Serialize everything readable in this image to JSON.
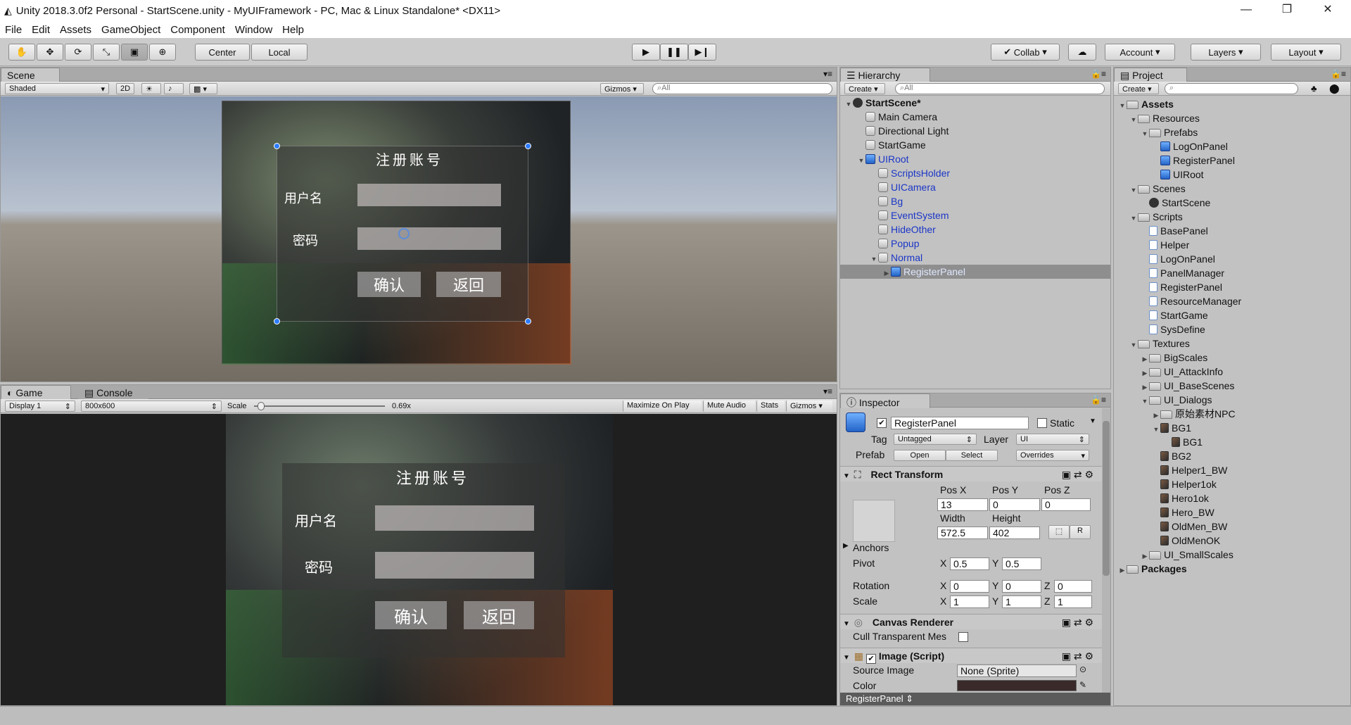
{
  "window": {
    "title": "Unity 2018.3.0f2 Personal - StartScene.unity - MyUIFramework - PC, Mac & Linux Standalone* <DX11>"
  },
  "menu": [
    "File",
    "Edit",
    "Assets",
    "GameObject",
    "Component",
    "Window",
    "Help"
  ],
  "toolbar": {
    "pivot": "Center",
    "space": "Local",
    "collab": "Collab",
    "account": "Account",
    "layers": "Layers",
    "layout": "Layout"
  },
  "scene": {
    "tab": "Scene",
    "shading": "Shaded",
    "mode2d": "2D",
    "gizmos": "Gizmos",
    "search": "All",
    "panel_title": "注册账号",
    "username_label": "用户名",
    "password_label": "密码",
    "confirm_label": "确认",
    "back_label": "返回"
  },
  "game": {
    "tab": "Game",
    "console_tab": "Console",
    "display": "Display 1",
    "resolution": "800x600",
    "scale_label": "Scale",
    "scale_value": "0.69x",
    "scale_fraction": 0.03,
    "maximize": "Maximize On Play",
    "mute": "Mute Audio",
    "stats": "Stats",
    "gizmos": "Gizmos",
    "panel_title": "注册账号",
    "username_label": "用户名",
    "password_label": "密码",
    "confirm_label": "确认",
    "back_label": "返回"
  },
  "hierarchy": {
    "tab": "Hierarchy",
    "create": "Create",
    "search": "All",
    "items": [
      {
        "label": "StartScene*",
        "depth": 0,
        "arrow": "open",
        "icon": "scene",
        "bold": true
      },
      {
        "label": "Main Camera",
        "depth": 1,
        "arrow": "",
        "icon": "go"
      },
      {
        "label": "Directional Light",
        "depth": 1,
        "arrow": "",
        "icon": "go"
      },
      {
        "label": "StartGame",
        "depth": 1,
        "arrow": "",
        "icon": "go"
      },
      {
        "label": "UIRoot",
        "depth": 1,
        "arrow": "open",
        "icon": "prefab",
        "blue": true
      },
      {
        "label": "ScriptsHolder",
        "depth": 2,
        "arrow": "",
        "icon": "go",
        "blue": true
      },
      {
        "label": "UICamera",
        "depth": 2,
        "arrow": "",
        "icon": "go",
        "blue": true
      },
      {
        "label": "Bg",
        "depth": 2,
        "arrow": "",
        "icon": "go",
        "blue": true
      },
      {
        "label": "EventSystem",
        "depth": 2,
        "arrow": "",
        "icon": "go",
        "blue": true
      },
      {
        "label": "HideOther",
        "depth": 2,
        "arrow": "",
        "icon": "go",
        "blue": true
      },
      {
        "label": "Popup",
        "depth": 2,
        "arrow": "",
        "icon": "go",
        "blue": true
      },
      {
        "label": "Normal",
        "depth": 2,
        "arrow": "open",
        "icon": "go",
        "blue": true
      },
      {
        "label": "RegisterPanel",
        "depth": 3,
        "arrow": "closed",
        "icon": "prefab",
        "selected": true
      }
    ]
  },
  "project": {
    "tab": "Project",
    "create": "Create",
    "items": [
      {
        "label": "Assets",
        "depth": 0,
        "arrow": "open",
        "icon": "folder",
        "bold": true
      },
      {
        "label": "Resources",
        "depth": 1,
        "arrow": "open",
        "icon": "folder"
      },
      {
        "label": "Prefabs",
        "depth": 2,
        "arrow": "open",
        "icon": "folder"
      },
      {
        "label": "LogOnPanel",
        "depth": 3,
        "arrow": "",
        "icon": "prefab"
      },
      {
        "label": "RegisterPanel",
        "depth": 3,
        "arrow": "",
        "icon": "prefab"
      },
      {
        "label": "UIRoot",
        "depth": 3,
        "arrow": "",
        "icon": "prefab"
      },
      {
        "label": "Scenes",
        "depth": 1,
        "arrow": "open",
        "icon": "folder"
      },
      {
        "label": "StartScene",
        "depth": 2,
        "arrow": "",
        "icon": "scene"
      },
      {
        "label": "Scripts",
        "depth": 1,
        "arrow": "open",
        "icon": "folder"
      },
      {
        "label": "BasePanel",
        "depth": 2,
        "arrow": "",
        "icon": "script"
      },
      {
        "label": "Helper",
        "depth": 2,
        "arrow": "",
        "icon": "script"
      },
      {
        "label": "LogOnPanel",
        "depth": 2,
        "arrow": "",
        "icon": "script"
      },
      {
        "label": "PanelManager",
        "depth": 2,
        "arrow": "",
        "icon": "script"
      },
      {
        "label": "RegisterPanel",
        "depth": 2,
        "arrow": "",
        "icon": "script"
      },
      {
        "label": "ResourceManager",
        "depth": 2,
        "arrow": "",
        "icon": "script"
      },
      {
        "label": "StartGame",
        "depth": 2,
        "arrow": "",
        "icon": "script"
      },
      {
        "label": "SysDefine",
        "depth": 2,
        "arrow": "",
        "icon": "script"
      },
      {
        "label": "Textures",
        "depth": 1,
        "arrow": "open",
        "icon": "folder"
      },
      {
        "label": "BigScales",
        "depth": 2,
        "arrow": "closed",
        "icon": "folder"
      },
      {
        "label": "UI_AttackInfo",
        "depth": 2,
        "arrow": "closed",
        "icon": "folder"
      },
      {
        "label": "UI_BaseScenes",
        "depth": 2,
        "arrow": "closed",
        "icon": "folder"
      },
      {
        "label": "UI_Dialogs",
        "depth": 2,
        "arrow": "open",
        "icon": "folder"
      },
      {
        "label": "原始素材NPC",
        "depth": 3,
        "arrow": "closed",
        "icon": "folder"
      },
      {
        "label": "BG1",
        "depth": 3,
        "arrow": "open",
        "icon": "tex"
      },
      {
        "label": "BG1",
        "depth": 4,
        "arrow": "",
        "icon": "tex"
      },
      {
        "label": "BG2",
        "depth": 3,
        "arrow": "",
        "icon": "tex"
      },
      {
        "label": "Helper1_BW",
        "depth": 3,
        "arrow": "",
        "icon": "tex"
      },
      {
        "label": "Helper1ok",
        "depth": 3,
        "arrow": "",
        "icon": "tex"
      },
      {
        "label": "Hero1ok",
        "depth": 3,
        "arrow": "",
        "icon": "tex"
      },
      {
        "label": "Hero_BW",
        "depth": 3,
        "arrow": "",
        "icon": "tex"
      },
      {
        "label": "OldMen_BW",
        "depth": 3,
        "arrow": "",
        "icon": "tex"
      },
      {
        "label": "OldMenOK",
        "depth": 3,
        "arrow": "",
        "icon": "tex"
      },
      {
        "label": "UI_SmallScales",
        "depth": 2,
        "arrow": "closed",
        "icon": "folder"
      },
      {
        "label": "Packages",
        "depth": 0,
        "arrow": "closed",
        "icon": "folder",
        "bold": true
      }
    ]
  },
  "inspector": {
    "tab": "Inspector",
    "object_name": "RegisterPanel",
    "static_label": "Static",
    "tag_label": "Tag",
    "tag_value": "Untagged",
    "layer_label": "Layer",
    "layer_value": "UI",
    "prefab_label": "Prefab",
    "open": "Open",
    "select": "Select",
    "overrides": "Overrides",
    "rect_transform": "Rect Transform",
    "pos_x_label": "Pos X",
    "pos_y_label": "Pos Y",
    "pos_z_label": "Pos Z",
    "pos_x": "13",
    "pos_y": "0",
    "pos_z": "0",
    "width_label": "Width",
    "height_label": "Height",
    "width": "572.5",
    "height": "402",
    "r_button": "R",
    "anchors": "Anchors",
    "pivot": "Pivot",
    "pivot_x": "0.5",
    "pivot_y": "0.5",
    "rotation": "Rotation",
    "rot_x": "0",
    "rot_y": "0",
    "rot_z": "0",
    "scale": "Scale",
    "scale_x": "1",
    "scale_y": "1",
    "scale_z": "1",
    "x": "X",
    "y": "Y",
    "z": "Z",
    "canvas_renderer": "Canvas Renderer",
    "cull": "Cull Transparent Mes",
    "image_script": "Image (Script)",
    "source_image_label": "Source Image",
    "source_image": "None (Sprite)",
    "color_label": "Color",
    "footer": "RegisterPanel"
  }
}
